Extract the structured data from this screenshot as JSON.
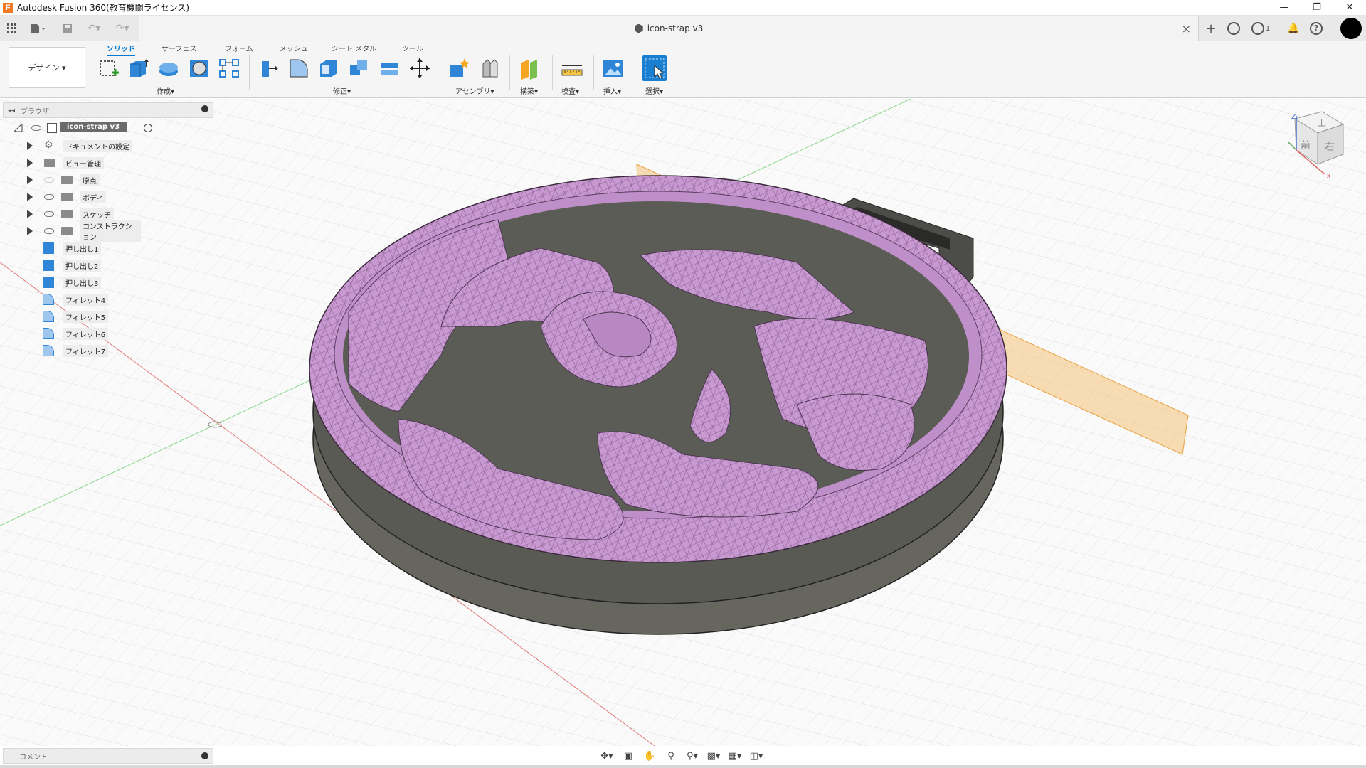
{
  "window": {
    "title": "Autodesk Fusion 360(教育機関ライセンス)",
    "minimize_icon": "minimize-icon",
    "restore_icon": "restore-icon",
    "close_icon": "close-icon"
  },
  "appbar": {
    "document_tab_title": "icon-strap v3",
    "job_status_count": "1"
  },
  "ribbon": {
    "workspace": "デザイン",
    "tabs": [
      "ソリッド",
      "サーフェス",
      "フォーム",
      "メッシュ",
      "シート メタル",
      "ツール"
    ],
    "active_tab": "ソリッド",
    "groups": {
      "create": "作成",
      "modify": "修正",
      "assemble": "アセンブリ",
      "construct": "構築",
      "inspect": "検査",
      "insert": "挿入",
      "select": "選択"
    }
  },
  "browser": {
    "header": "ブラウザ",
    "root": "icon-strap v3",
    "folders": [
      "ドキュメントの設定",
      "ビュー管理",
      "原点",
      "ボディ",
      "スケッチ",
      "コンストラクション"
    ],
    "features": [
      "押し出し1",
      "押し出し2",
      "押し出し3",
      "フィレット4",
      "フィレット5",
      "フィレット6",
      "フィレット7"
    ]
  },
  "viewcube": {
    "top": "上",
    "front": "前",
    "right": "右",
    "axis_z": "Z",
    "axis_x": "X"
  },
  "comments": {
    "label": "コメント"
  },
  "colors": {
    "accent": "#0078d4",
    "mesh": "#c79ad0",
    "base": "#6a6a65",
    "plane": "#f5b55a"
  }
}
